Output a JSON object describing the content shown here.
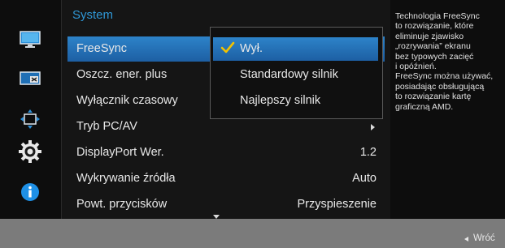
{
  "rail": {
    "icons": [
      "picture-icon",
      "onscreen-display-icon",
      "position-size-icon",
      "system-gear-icon",
      "information-icon"
    ],
    "selected": "system-gear-icon"
  },
  "menu": {
    "title": "System",
    "items": [
      {
        "label": "FreeSync",
        "value": ""
      },
      {
        "label": "Oszcz. ener. plus",
        "value": ""
      },
      {
        "label": "Wyłącznik czasowy",
        "value": ""
      },
      {
        "label": "Tryb PC/AV",
        "value": ""
      },
      {
        "label": "DisplayPort Wer.",
        "value": "1.2"
      },
      {
        "label": "Wykrywanie źródła",
        "value": "Auto"
      },
      {
        "label": "Powt. przycisków",
        "value": "Przyspieszenie"
      }
    ]
  },
  "submenu": {
    "options": [
      "Wył.",
      "Standardowy silnik",
      "Najlepszy silnik"
    ],
    "selected": "Wył."
  },
  "help": {
    "text": "Technologia FreeSync\nto rozwiązanie, które\neliminuje zjawisko\n„rozrywania” ekranu\nbez typowych zacięć\ni opóźnień.\nFreeSync można używać,\nposiadając obsługującą\nto rozwiązanie kartę\ngraficzną AMD."
  },
  "footer": {
    "back_label": "Wróć"
  },
  "colors": {
    "accent": "#2f97d6",
    "selection": "#2a7cc3",
    "check": "#f2c200",
    "info": "#1e90e6"
  }
}
